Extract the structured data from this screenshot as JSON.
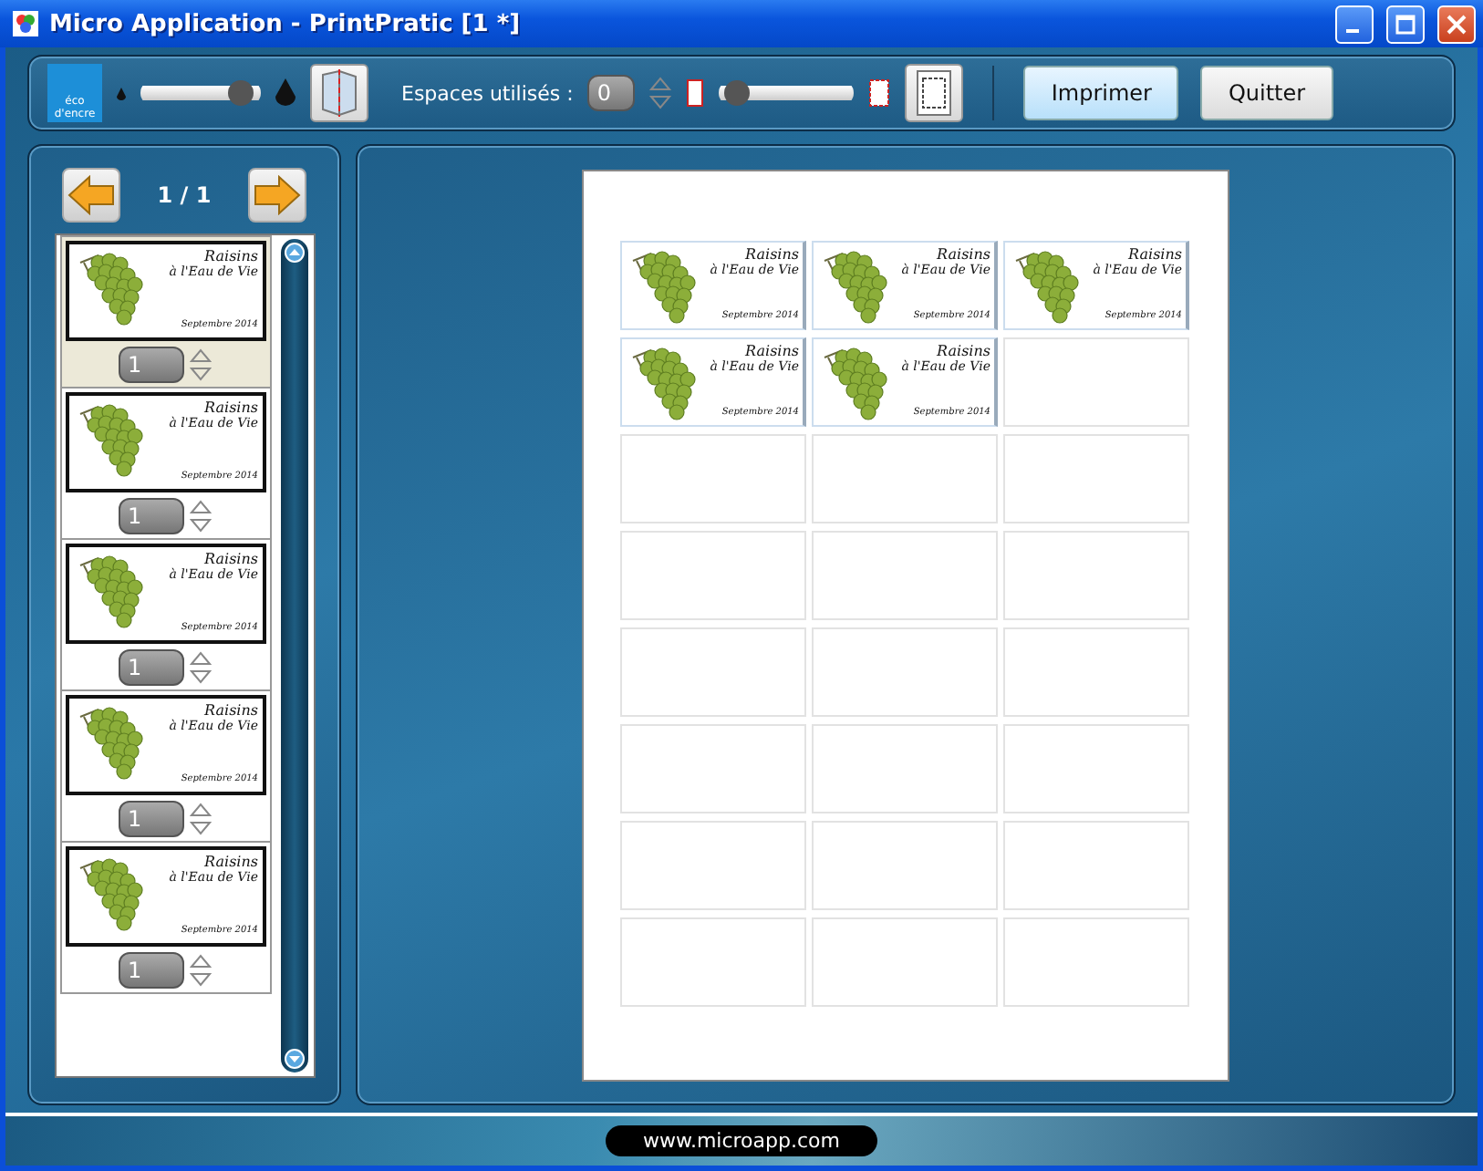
{
  "window": {
    "title": "Micro Application - PrintPratic [1 *]"
  },
  "toolbar": {
    "logo_top": "éco",
    "logo_bottom": "d'encre",
    "ink_slider": {
      "level": 0.93
    },
    "spaces_label": "Espaces utilisés :",
    "spaces_value": "0",
    "margin_slider": {
      "level": 0.04
    },
    "buttons": [
      {
        "label": "Imprimer",
        "kind": "primary"
      },
      {
        "label": "Quitter",
        "kind": "normal"
      }
    ]
  },
  "pager": {
    "page": "1 / 1"
  },
  "thumbnails": [
    {
      "selected": true,
      "count": "1",
      "label": {
        "title": "Raisins",
        "subtitle": "à l'Eau de Vie",
        "date": "Septembre 2014"
      }
    },
    {
      "selected": false,
      "count": "1",
      "label": {
        "title": "Raisins",
        "subtitle": "à l'Eau de Vie",
        "date": "Septembre 2014"
      }
    },
    {
      "selected": false,
      "count": "1",
      "label": {
        "title": "Raisins",
        "subtitle": "à l'Eau de Vie",
        "date": "Septembre 2014"
      }
    },
    {
      "selected": false,
      "count": "1",
      "label": {
        "title": "Raisins",
        "subtitle": "à l'Eau de Vie",
        "date": "Septembre 2014"
      }
    },
    {
      "selected": false,
      "count": "1",
      "label": {
        "title": "Raisins",
        "subtitle": "à l'Eau de Vie",
        "date": "Septembre 2014"
      }
    }
  ],
  "sheet": {
    "cells": [
      {
        "label": {
          "title": "Raisins",
          "subtitle": "à l'Eau de Vie",
          "date": "Septembre 2014"
        }
      },
      {
        "label": {
          "title": "Raisins",
          "subtitle": "à l'Eau de Vie",
          "date": "Septembre 2014"
        }
      },
      {
        "label": {
          "title": "Raisins",
          "subtitle": "à l'Eau de Vie",
          "date": "Septembre 2014"
        }
      },
      {
        "label": {
          "title": "Raisins",
          "subtitle": "à l'Eau de Vie",
          "date": "Septembre 2014"
        }
      },
      {
        "label": {
          "title": "Raisins",
          "subtitle": "à l'Eau de Vie",
          "date": "Septembre 2014"
        }
      },
      {},
      {},
      {},
      {},
      {},
      {},
      {},
      {},
      {},
      {},
      {},
      {},
      {},
      {},
      {},
      {},
      {},
      {},
      {}
    ]
  },
  "footer": {
    "url": "www.microapp.com"
  }
}
